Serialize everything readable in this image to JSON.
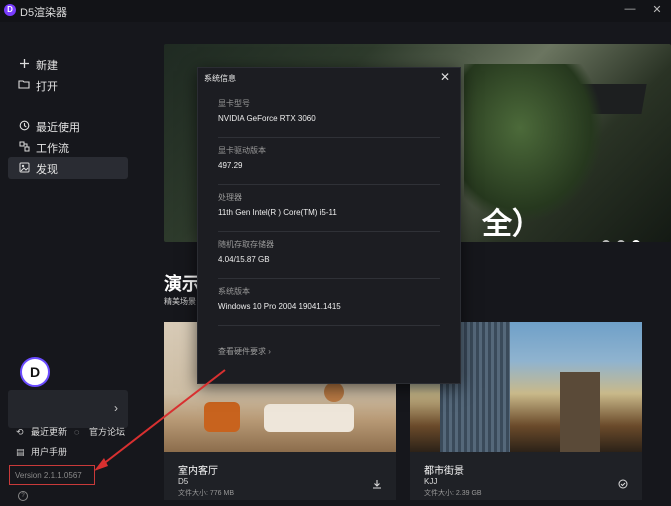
{
  "app": {
    "title": "D5渲染器",
    "logo_letter": "D",
    "minimize": "—",
    "close": "✕"
  },
  "sidebar": {
    "items": [
      {
        "icon": "plus-icon",
        "label": "新建"
      },
      {
        "icon": "folder-icon",
        "label": "打开"
      },
      {
        "icon": "history-icon",
        "label": "最近使用"
      },
      {
        "icon": "workflow-icon",
        "label": "工作流"
      },
      {
        "icon": "discover-icon",
        "label": "发现"
      }
    ],
    "active_item": "发现",
    "avatar_letter": "D",
    "user_card_chevron": "›",
    "links": [
      {
        "icon": "refresh-icon",
        "label": "最近更新"
      },
      {
        "icon": "chat-icon",
        "label": "官方论坛"
      },
      {
        "icon": "book-icon",
        "label": "用户手册"
      }
    ],
    "version": "Version 2.1.1.0567"
  },
  "hero": {
    "title_fragment": "全）",
    "carousel_count": 3,
    "carousel_active": 3
  },
  "section": {
    "title_fragment": "演示",
    "subtitle_fragment": "精美场景"
  },
  "cards": [
    {
      "name": "室内客厅",
      "author": "D5",
      "size": "文件大小: 776 MB",
      "action": "download-icon"
    },
    {
      "name": "都市街景",
      "author": "KJJ",
      "size": "文件大小: 2.39 GB",
      "action": "check-circle-icon"
    }
  ],
  "dialog": {
    "title": "系统信息",
    "rows": [
      {
        "label": "显卡型号",
        "value": "NVIDIA GeForce RTX 3060"
      },
      {
        "label": "显卡驱动版本",
        "value": "497.29"
      },
      {
        "label": "处理器",
        "value": "11th Gen Intel(R ) Core(TM) i5-11"
      },
      {
        "label": "随机存取存储器",
        "value": "4.04/15.87 GB"
      },
      {
        "label": "系统版本",
        "value": "Windows 10 Pro 2004 19041.1415"
      }
    ],
    "hardware_link": "查看硬件要求 ›"
  },
  "colors": {
    "accent": "#7a3cff",
    "annotation": "#c93a3a",
    "background": "#16171c"
  }
}
